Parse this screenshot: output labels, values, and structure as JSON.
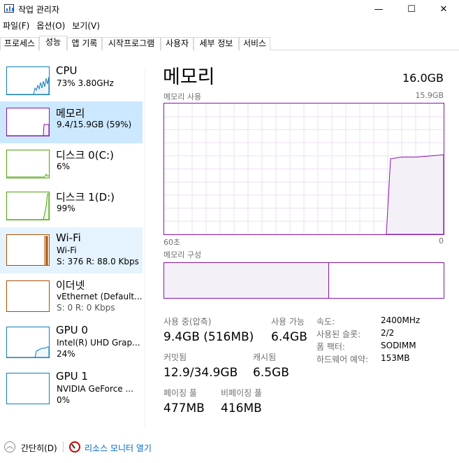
{
  "window": {
    "title": "작업 관리자",
    "minimize": "—",
    "maximize": "☐",
    "close": "✕"
  },
  "menu": [
    "파일(F)",
    "옵션(O)",
    "보기(V)"
  ],
  "tabs": [
    "프로세스",
    "성능",
    "앱 기록",
    "시작프로그램",
    "사용자",
    "세부 정보",
    "서비스"
  ],
  "active_tab": "성능",
  "sidebar": [
    {
      "name": "CPU",
      "line1": "73% 3.80GHz",
      "line2": "",
      "color": "#117dbb"
    },
    {
      "name": "메모리",
      "line1": "9.4/15.9GB (59%)",
      "line2": "",
      "color": "#8b12ae"
    },
    {
      "name": "디스크 0(C:)",
      "line1": "6%",
      "line2": "",
      "color": "#4da60c"
    },
    {
      "name": "디스크 1(D:)",
      "line1": "99%",
      "line2": "",
      "color": "#4da60c"
    },
    {
      "name": "Wi-Fi",
      "line1": "Wi-Fi",
      "line2": "S: 376  R: 88.0 Kbps",
      "color": "#a74f01"
    },
    {
      "name": "이더넷",
      "line1": "vEthernet (Default...",
      "line2": "S: 0  R: 0 Kbps",
      "color": "#a74f01"
    },
    {
      "name": "GPU 0",
      "line1": "Intel(R) UHD Grap...",
      "line2": "24%",
      "color": "#117dbb"
    },
    {
      "name": "GPU 1",
      "line1": "NVIDIA GeForce ...",
      "line2": "0%",
      "color": "#117dbb"
    }
  ],
  "main": {
    "title": "메모리",
    "total": "16.0GB",
    "usage_label": "메모리 사용",
    "usage_max": "15.9GB",
    "axis_left": "60초",
    "axis_right": "0",
    "composition_label": "메모리 구성",
    "in_use_fraction": 0.59
  },
  "stats": {
    "in_use_label": "사용 중(압축)",
    "in_use_value": "9.4GB (516MB)",
    "available_label": "사용 가능",
    "available_value": "6.4GB",
    "committed_label": "커밋됨",
    "committed_value": "12.9/34.9GB",
    "cached_label": "캐시됨",
    "cached_value": "6.5GB",
    "paged_label": "페이징 풀",
    "paged_value": "477MB",
    "nonpaged_label": "비페이징 풀",
    "nonpaged_value": "416MB"
  },
  "details": [
    {
      "label": "속도:",
      "value": "2400MHz"
    },
    {
      "label": "사용된 슬롯:",
      "value": "2/2"
    },
    {
      "label": "폼 팩터:",
      "value": "SODIMM"
    },
    {
      "label": "하드웨어 예약:",
      "value": "153MB"
    }
  ],
  "footer": {
    "fewer": "간단히(D)",
    "resmon": "리소스 모니터 열기"
  }
}
